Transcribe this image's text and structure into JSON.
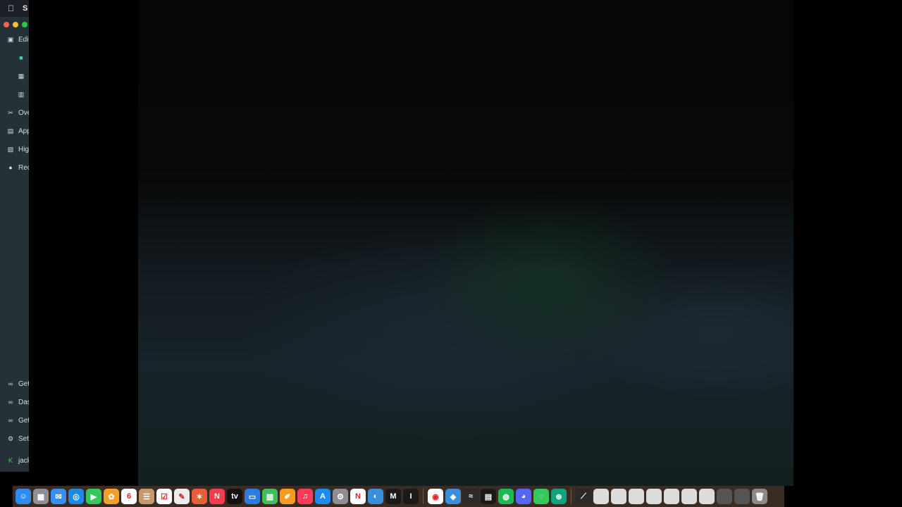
{
  "menubar": {
    "app_name": "S"
  },
  "sidebar": {
    "items": [
      {
        "label": "Editi",
        "icon": "folder-video-icon",
        "indent": false
      },
      {
        "label": "",
        "icon": "camera-icon",
        "indent": true
      },
      {
        "label": "",
        "icon": "grid-icon",
        "indent": true
      },
      {
        "label": "",
        "icon": "columns-icon",
        "indent": true
      },
      {
        "label": "Ove",
        "icon": "tools-icon",
        "indent": false
      },
      {
        "label": "App",
        "icon": "store-icon",
        "indent": false
      },
      {
        "label": "Higl",
        "icon": "highlight-icon",
        "indent": false
      },
      {
        "label": "Rec",
        "icon": "record-icon",
        "indent": false
      }
    ],
    "bottom_items": [
      {
        "label": "Get",
        "icon": "link-icon"
      },
      {
        "label": "Das",
        "icon": "link-icon"
      },
      {
        "label": "Get",
        "icon": "link-icon"
      },
      {
        "label": "Sett",
        "icon": "gear-icon"
      },
      {
        "label": "jack",
        "icon": "k-logo-icon"
      }
    ]
  },
  "dock": {
    "apps": [
      {
        "name": "finder-icon",
        "color": "#2f8bf0",
        "glyph": "☺"
      },
      {
        "name": "launchpad-icon",
        "color": "#8e8e93",
        "glyph": "▦"
      },
      {
        "name": "mail-icon",
        "color": "#3a8ef0",
        "glyph": "✉"
      },
      {
        "name": "safari-icon",
        "color": "#1e88e5",
        "glyph": "◎"
      },
      {
        "name": "facetime-icon",
        "color": "#34c759",
        "glyph": "▶"
      },
      {
        "name": "photos-icon",
        "color": "#f1a12b",
        "glyph": "✿"
      },
      {
        "name": "calendar-icon",
        "color": "#ffffff",
        "glyph": "6"
      },
      {
        "name": "contacts-icon",
        "color": "#c49a6c",
        "glyph": "☰"
      },
      {
        "name": "reminders-icon",
        "color": "#ffffff",
        "glyph": "☑"
      },
      {
        "name": "notes-icon",
        "color": "#ececec",
        "glyph": "✎"
      },
      {
        "name": "freeform-icon",
        "color": "#e85d3a",
        "glyph": "✶"
      },
      {
        "name": "news-icon",
        "color": "#f23c4f",
        "glyph": "N"
      },
      {
        "name": "appletv-icon",
        "color": "#111111",
        "glyph": "tv"
      },
      {
        "name": "keynote-icon",
        "color": "#2a7de1",
        "glyph": "▭"
      },
      {
        "name": "numbers-icon",
        "color": "#3fbf5b",
        "glyph": "▥"
      },
      {
        "name": "pages-icon",
        "color": "#f59b23",
        "glyph": "✐"
      },
      {
        "name": "music-icon",
        "color": "#fa3c5a",
        "glyph": "♫"
      },
      {
        "name": "appstore-icon",
        "color": "#1a8cf0",
        "glyph": "A"
      },
      {
        "name": "settings-icon",
        "color": "#8e8e93",
        "glyph": "⚙"
      },
      {
        "name": "netflix-icon",
        "color": "#ffffff",
        "glyph": "N"
      },
      {
        "name": "preview-icon",
        "color": "#3b8fd9",
        "glyph": "◐"
      },
      {
        "name": "medium-icon",
        "color": "#1a1a1a",
        "glyph": "M"
      },
      {
        "name": "textedit-icon",
        "color": "#1a1a1a",
        "glyph": "I"
      }
    ],
    "apps2": [
      {
        "name": "chrome-icon",
        "color": "#ffffff",
        "glyph": "◉"
      },
      {
        "name": "proxyman-icon",
        "color": "#3b8fd9",
        "glyph": "◈"
      },
      {
        "name": "waveform-icon",
        "color": "#2a2a2a",
        "glyph": "≈"
      },
      {
        "name": "piano-icon",
        "color": "#1a1a1a",
        "glyph": "▤"
      },
      {
        "name": "spotify-icon",
        "color": "#1db954",
        "glyph": "◍"
      },
      {
        "name": "discord-icon",
        "color": "#5865f2",
        "glyph": "◕"
      },
      {
        "name": "messages-icon",
        "color": "#34c759",
        "glyph": "◌"
      },
      {
        "name": "chatgpt-icon",
        "color": "#10a37f",
        "glyph": "⊛"
      }
    ],
    "apps3": [
      {
        "name": "pencil-icon",
        "color": "#2a2a2a",
        "glyph": "⟋"
      },
      {
        "name": "window-thumb-icon",
        "color": "#dcdcdc",
        "glyph": ""
      },
      {
        "name": "window-thumb-icon",
        "color": "#dcdcdc",
        "glyph": ""
      },
      {
        "name": "window-thumb-icon",
        "color": "#dcdcdc",
        "glyph": ""
      },
      {
        "name": "window-thumb-icon",
        "color": "#dcdcdc",
        "glyph": ""
      },
      {
        "name": "window-thumb-icon",
        "color": "#dcdcdc",
        "glyph": ""
      },
      {
        "name": "window-thumb-icon",
        "color": "#dcdcdc",
        "glyph": ""
      },
      {
        "name": "window-thumb-icon",
        "color": "#dcdcdc",
        "glyph": ""
      },
      {
        "name": "folder-icon",
        "color": "#555555",
        "glyph": ""
      },
      {
        "name": "downloads-icon",
        "color": "#555555",
        "glyph": ""
      },
      {
        "name": "trash-icon",
        "color": "#8a8a8a",
        "glyph": "🗑"
      }
    ]
  }
}
